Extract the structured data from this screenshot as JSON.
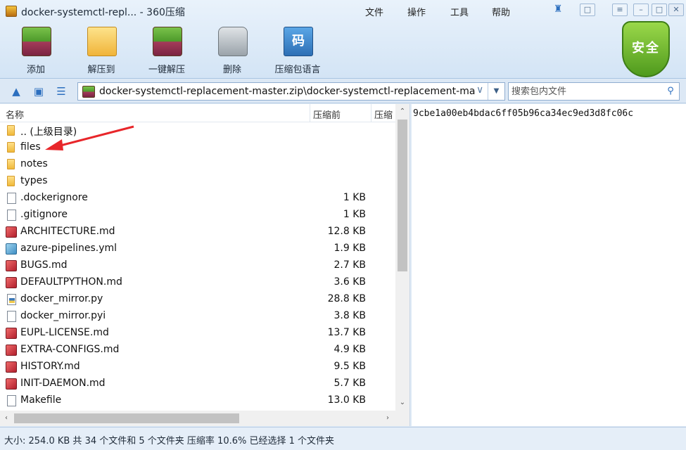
{
  "window": {
    "title": "docker-systemctl-repl... - 360压缩",
    "menu": [
      "文件",
      "操作",
      "工具",
      "帮助"
    ]
  },
  "toolbar": {
    "add_label": "添加",
    "extract_label": "解压到",
    "oneclick_label": "一键解压",
    "delete_label": "删除",
    "lang_label": "压缩包语言",
    "lang_glyph": "码",
    "security_label": "安全"
  },
  "address": {
    "path": "docker-systemctl-replacement-master.zip\\docker-systemctl-replacement-master",
    "search_placeholder": "搜索包内文件"
  },
  "file_list": {
    "columns": {
      "name": "名称",
      "size": "压缩前",
      "packed": "压缩"
    },
    "rows": [
      {
        "name": ".. (上级目录)",
        "size": "",
        "type": "folder"
      },
      {
        "name": "files",
        "size": "",
        "type": "folder"
      },
      {
        "name": "notes",
        "size": "",
        "type": "folder"
      },
      {
        "name": "types",
        "size": "",
        "type": "folder"
      },
      {
        "name": ".dockerignore",
        "size": "1 KB",
        "type": "doc"
      },
      {
        "name": ".gitignore",
        "size": "1 KB",
        "type": "doc"
      },
      {
        "name": "ARCHITECTURE.md",
        "size": "12.8 KB",
        "type": "md"
      },
      {
        "name": "azure-pipelines.yml",
        "size": "1.9 KB",
        "type": "yml"
      },
      {
        "name": "BUGS.md",
        "size": "2.7 KB",
        "type": "md"
      },
      {
        "name": "DEFAULTPYTHON.md",
        "size": "3.6 KB",
        "type": "md"
      },
      {
        "name": "docker_mirror.py",
        "size": "28.8 KB",
        "type": "py"
      },
      {
        "name": "docker_mirror.pyi",
        "size": "3.8 KB",
        "type": "doc"
      },
      {
        "name": "EUPL-LICENSE.md",
        "size": "13.7 KB",
        "type": "md"
      },
      {
        "name": "EXTRA-CONFIGS.md",
        "size": "4.9 KB",
        "type": "md"
      },
      {
        "name": "HISTORY.md",
        "size": "9.5 KB",
        "type": "md"
      },
      {
        "name": "INIT-DAEMON.md",
        "size": "5.7 KB",
        "type": "md"
      },
      {
        "name": "Makefile",
        "size": "13.0 KB",
        "type": "doc"
      }
    ]
  },
  "preview": {
    "hash": "9cbe1a00eb4bdac6ff05b96ca34ec9ed3d8fc06c"
  },
  "status": {
    "text": "大小: 254.0 KB 共 34 个文件和 5 个文件夹 压缩率 10.6% 已经选择 1 个文件夹"
  }
}
